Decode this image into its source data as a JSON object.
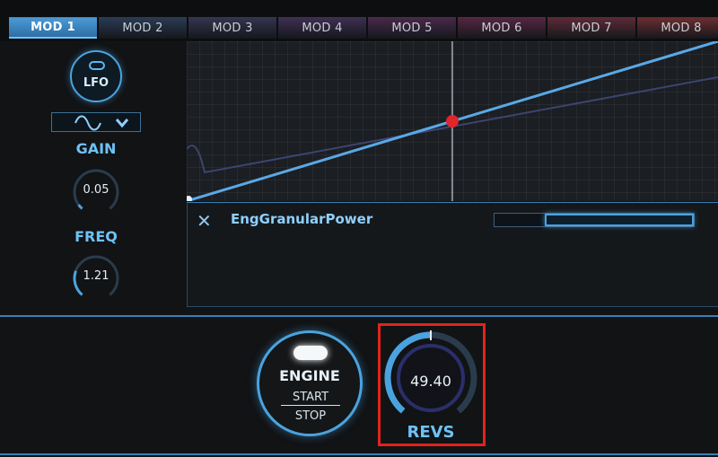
{
  "tabs": [
    {
      "label": "MOD 1",
      "color": "#3a86c0"
    },
    {
      "label": "MOD 2",
      "color": "#2a3a52"
    },
    {
      "label": "MOD 3",
      "color": "#35334f"
    },
    {
      "label": "MOD 4",
      "color": "#3e2f51"
    },
    {
      "label": "MOD 5",
      "color": "#48284a"
    },
    {
      "label": "MOD 6",
      "color": "#542641"
    },
    {
      "label": "MOD 7",
      "color": "#5c2a37"
    },
    {
      "label": "MOD 8",
      "color": "#6a2d31"
    }
  ],
  "active_tab": 0,
  "left_panel": {
    "lfo_label": "LFO",
    "waveform_icon": "sine-wave-icon",
    "dropdown_icon": "chevron-down-icon",
    "gain": {
      "label": "GAIN",
      "value": "0.05",
      "level": 0.05
    },
    "freq": {
      "label": "FREQ",
      "value": "1.21",
      "level": 0.25
    }
  },
  "graph": {
    "cursor_fraction": 0.5,
    "curve_color": "#5aa8e6",
    "cursor_color": "#e0262b"
  },
  "parameter": {
    "close_icon": "close-icon",
    "name": "EngGranularPower",
    "range": {
      "start": 0.25,
      "end": 1.0
    }
  },
  "engine": {
    "label": "ENGINE",
    "start_label": "START",
    "stop_label": "STOP"
  },
  "revs": {
    "value": "49.40",
    "label": "REVS",
    "level": 0.5
  },
  "colors": {
    "accent": "#4aa3df",
    "highlight_box": "#e1231c"
  }
}
